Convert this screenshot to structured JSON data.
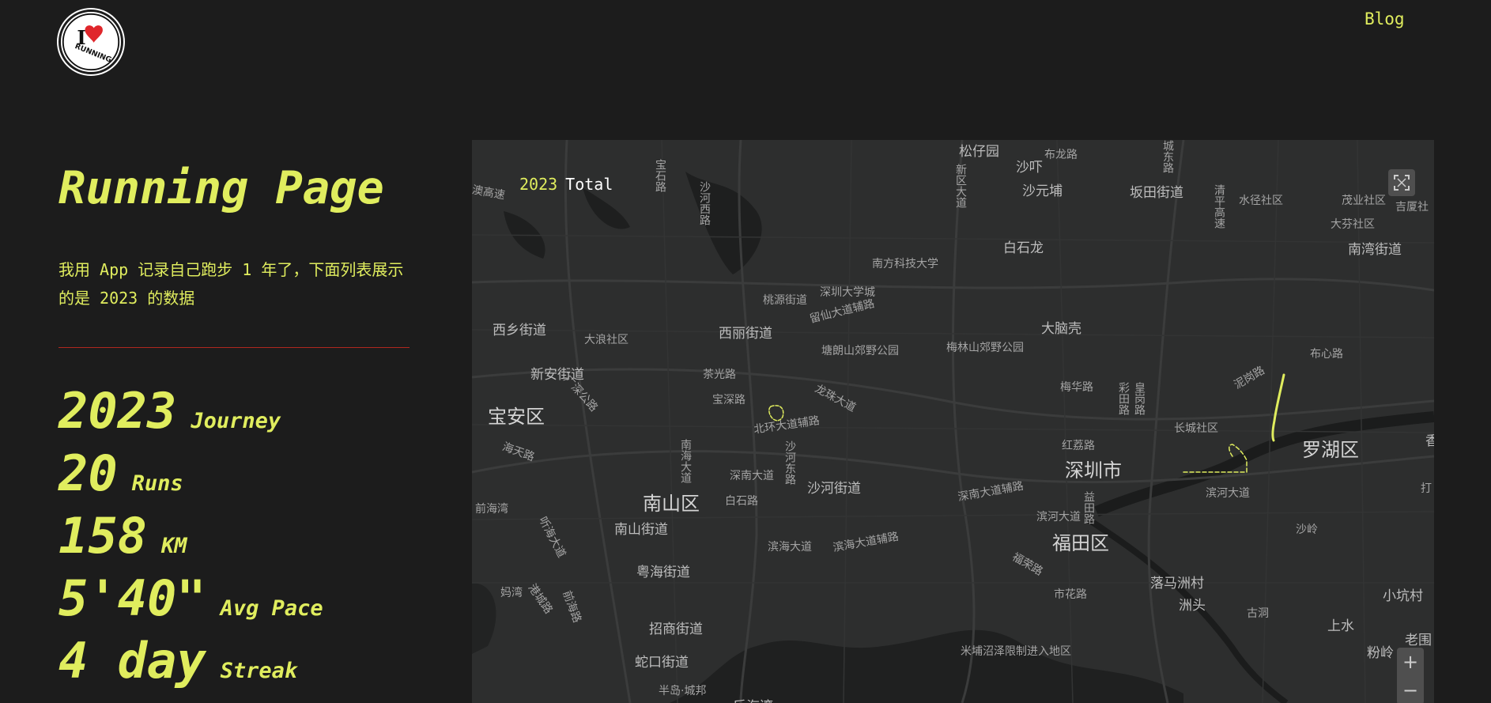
{
  "logo": {
    "alt": "I Running",
    "text_top": "I",
    "text_bottom": "RUNNING"
  },
  "nav": {
    "blog": "Blog"
  },
  "hero": {
    "title": "Running Page",
    "description": "我用 App 记录自己跑步 1 年了，下面列表展示的是 2023 的数据"
  },
  "stats": [
    {
      "value": "2023",
      "unit": "Journey"
    },
    {
      "value": "20",
      "unit": "Runs"
    },
    {
      "value": "158",
      "unit": "KM"
    },
    {
      "value": "5'40\"",
      "unit": "Avg Pace"
    },
    {
      "value": "4 day",
      "unit": "Streak"
    }
  ],
  "map": {
    "overlay": {
      "year": "2023",
      "total": "Total"
    },
    "controls": {
      "zoom_in": "+",
      "zoom_out": "−"
    },
    "labels": [
      "松仔园",
      "沙吓",
      "布龙路",
      "城东路",
      "新区大道",
      "沙元埔",
      "坂田街道",
      "清平高速",
      "水径社区",
      "茂业社区",
      "吉厦社",
      "大芬社区",
      "南湾街道",
      "宝石路",
      "沙河西路",
      "白石龙",
      "南方科技大学",
      "深圳大学城",
      "桃源街道",
      "留仙大道辅路",
      "大脑壳",
      "塘朗山郊野公园",
      "梅林山郊野公园",
      "西乡街道",
      "大浪社区",
      "西丽街道",
      "新安街道",
      "茶光路",
      "广深公路",
      "宝深路",
      "龙珠大道",
      "梅华路",
      "彩田路",
      "皇岗路",
      "泥岗路",
      "布心路",
      "宝安区",
      "北环大道辅路",
      "长城社区",
      "罗湖区",
      "海天路",
      "红荔路",
      "深圳市",
      "南海大道",
      "沙河东路",
      "深南大道",
      "白石路",
      "沙河街道",
      "深南大道辅路",
      "滨河大道",
      "滨河大道",
      "益田路",
      "南山区",
      "南山街道",
      "前海湾",
      "福田区",
      "滨海大道",
      "滨海大道辅路",
      "沙岭",
      "听海大道",
      "粤海街道",
      "福荣路",
      "落马洲村",
      "妈湾",
      "港城路",
      "前海路",
      "市花路",
      "洲头",
      "古洞",
      "小坑村",
      "上水",
      "老围",
      "招商街道",
      "米埔沼泽限制进入地区",
      "粉岭",
      "蛇口街道",
      "半岛·城邦",
      "后海湾",
      "澳高速",
      "打",
      "香"
    ]
  },
  "colors": {
    "accent": "#e0ed5e",
    "background": "#1c1c1c",
    "divider": "#b0271e",
    "route": "#e0ed5e",
    "logo_heart": "#e0262b"
  },
  "icons": [
    "fullscreen-icon",
    "zoom-in-icon",
    "zoom-out-icon",
    "heart-icon"
  ]
}
